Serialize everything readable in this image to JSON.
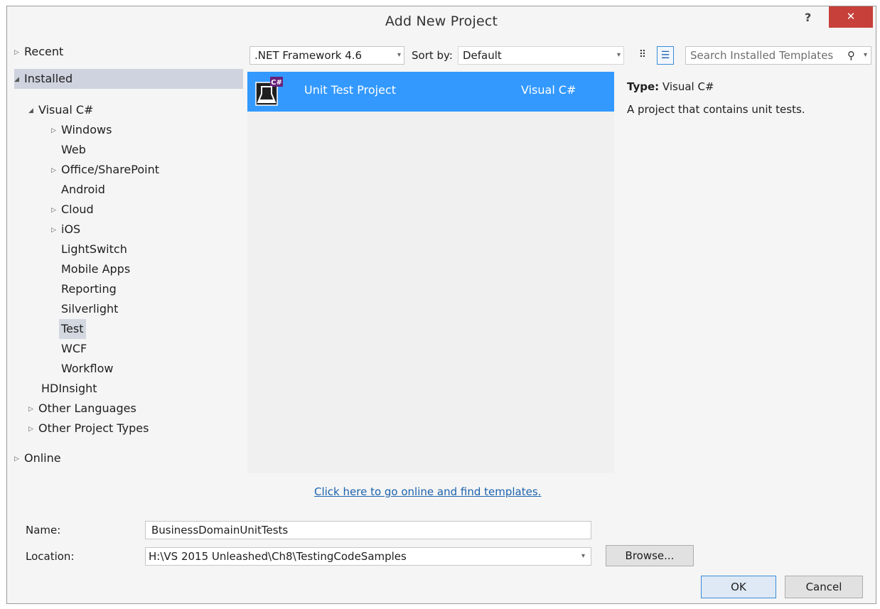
{
  "dialog": {
    "title": "Add New Project",
    "help_label": "?",
    "close_label": "✕"
  },
  "tree": {
    "recent": "Recent",
    "installed": "Installed",
    "visual_csharp": "Visual C#",
    "windows": "Windows",
    "web": "Web",
    "office": "Office/SharePoint",
    "android": "Android",
    "cloud": "Cloud",
    "ios": "iOS",
    "lightswitch": "LightSwitch",
    "mobile_apps": "Mobile Apps",
    "reporting": "Reporting",
    "silverlight": "Silverlight",
    "test": "Test",
    "wcf": "WCF",
    "workflow": "Workflow",
    "hdinsight": "HDInsight",
    "other_languages": "Other Languages",
    "other_project_types": "Other Project Types",
    "online": "Online"
  },
  "toolbar": {
    "framework": ".NET Framework 4.6",
    "sort_label": "Sort by:",
    "sort_value": "Default",
    "search_placeholder": "Search Installed Templates"
  },
  "templates": [
    {
      "name": "Unit Test Project",
      "language": "Visual C#",
      "badge": "C#"
    }
  ],
  "details": {
    "type_label": "Type:",
    "type_value": "Visual C#",
    "description": "A project that contains unit tests."
  },
  "online_link": "Click here to go online and find templates.",
  "form": {
    "name_label": "Name:",
    "name_value": "BusinessDomainUnitTests",
    "location_label": "Location:",
    "location_value": "H:\\VS 2015 Unleashed\\Ch8\\TestingCodeSamples",
    "browse_label": "Browse...",
    "ok_label": "OK",
    "cancel_label": "Cancel"
  },
  "colors": {
    "selection": "#3399ff",
    "close_button": "#c7403a",
    "link": "#1c62ad"
  }
}
